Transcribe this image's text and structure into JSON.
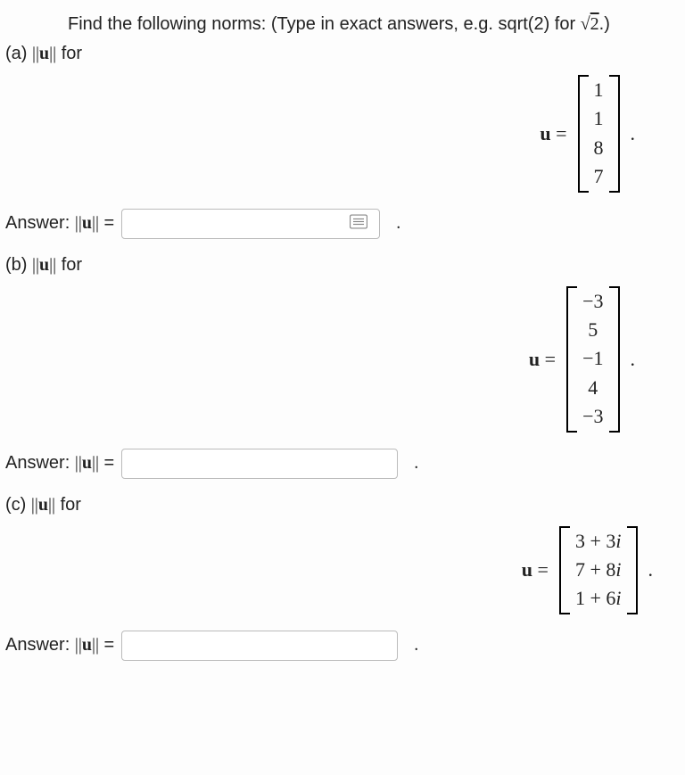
{
  "intro": {
    "text_prefix": "Find the following norms: (Type in exact answers, e.g. sqrt(2) for ",
    "sqrt_symbol": "√",
    "sqrt_arg": "2",
    "text_suffix": ".)"
  },
  "parts": {
    "a": {
      "label_prefix": "(a) ",
      "norm_text": "||u||",
      "label_suffix": " for",
      "lhs": "u =",
      "vector": [
        "1",
        "1",
        "8",
        "7"
      ],
      "answer_prefix": "Answer: ",
      "answer_norm": "||u||",
      "answer_eq": " = ",
      "has_icon": true
    },
    "b": {
      "label_prefix": "(b) ",
      "norm_text": "||u||",
      "label_suffix": " for",
      "lhs": "u =",
      "vector": [
        "−3",
        "5",
        "−1",
        "4",
        "−3"
      ],
      "answer_prefix": "Answer: ",
      "answer_norm": "||u||",
      "answer_eq": " = "
    },
    "c": {
      "label_prefix": "(c) ",
      "norm_text": "||u||",
      "label_suffix": " for",
      "lhs": "u =",
      "vector": [
        "3 + 3i",
        "7 + 8i",
        "1 + 6i"
      ],
      "answer_prefix": "Answer: ",
      "answer_norm": "||u||",
      "answer_eq": " = "
    }
  },
  "chart_data": {
    "type": "table",
    "description": "Three column vectors whose 2-norms are requested",
    "vectors": {
      "a": [
        1,
        1,
        8,
        7
      ],
      "b": [
        -3,
        5,
        -1,
        4,
        -3
      ],
      "c": [
        "3+3i",
        "7+8i",
        "1+6i"
      ]
    }
  }
}
